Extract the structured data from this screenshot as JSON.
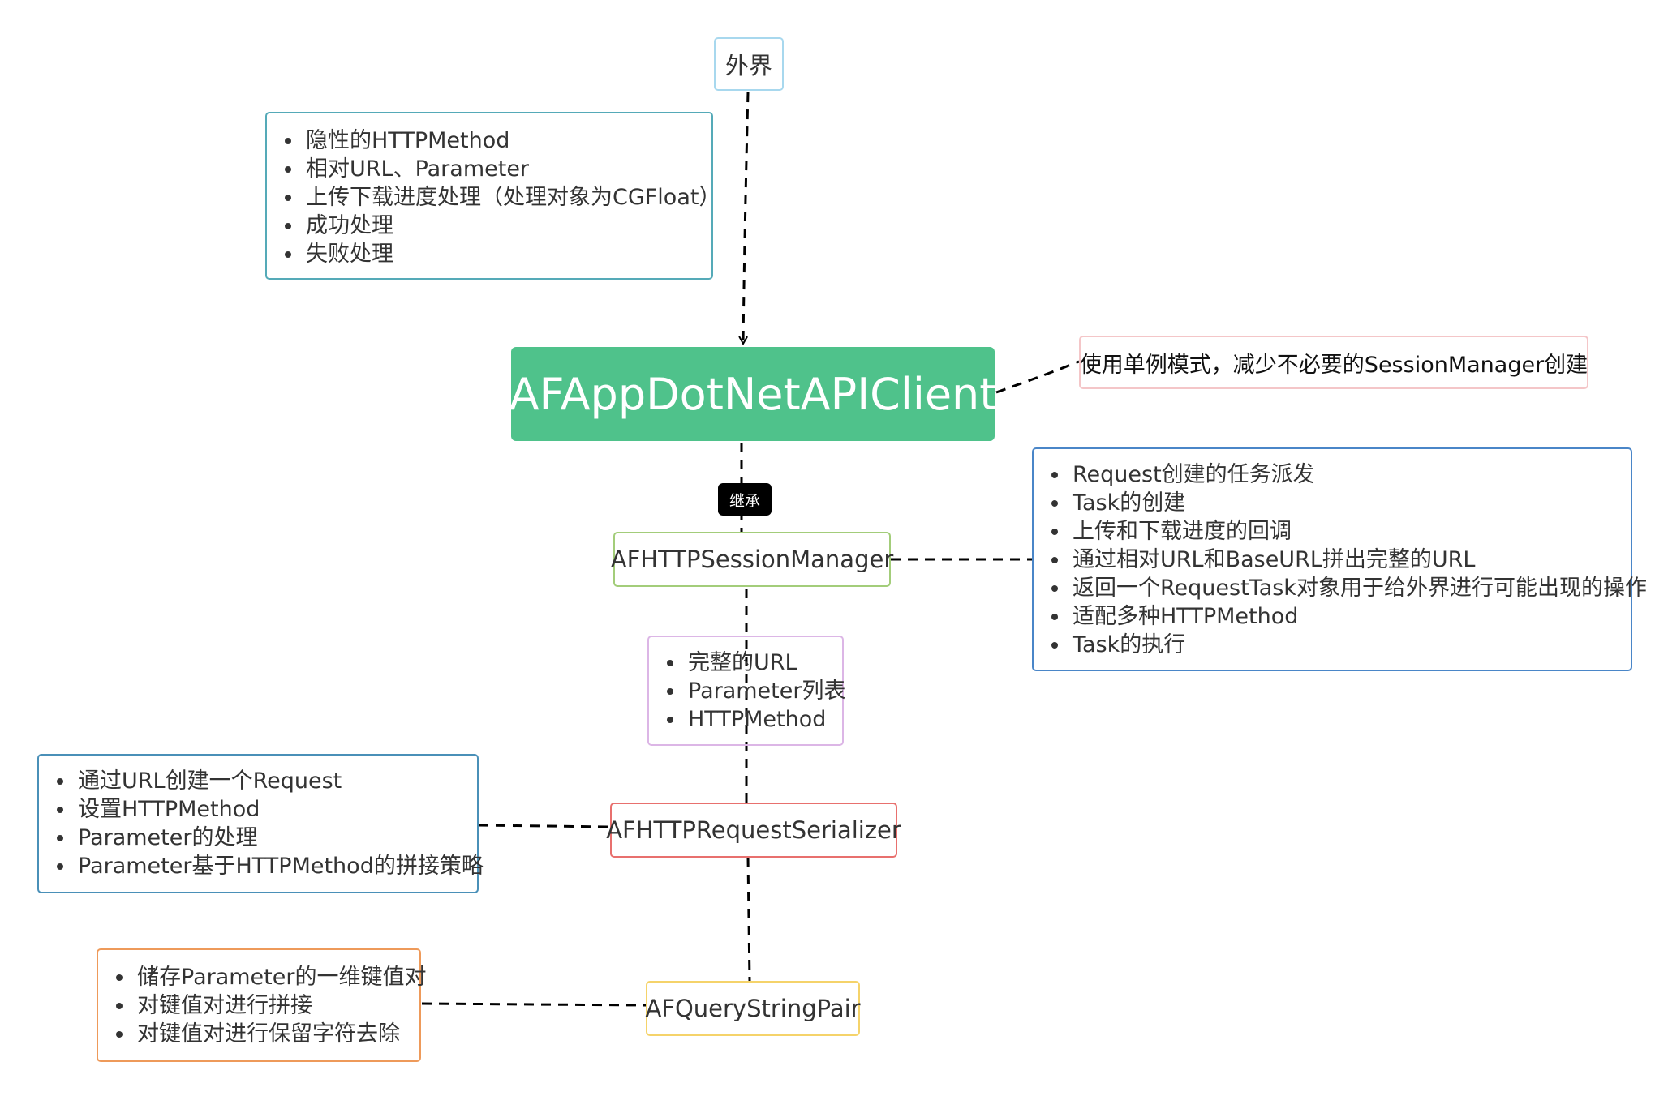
{
  "nodes": {
    "outside": "外界",
    "root": "AFAppDotNetAPIClient",
    "session_manager": "AFHTTPSessionManager",
    "request_serializer": "AFHTTPRequestSerializer",
    "query_string_pair": "AFQueryStringPair"
  },
  "edge_labels": {
    "inherit": "继承"
  },
  "notes": {
    "client_inputs": [
      "隐性的HTTPMethod",
      "相对URL、Parameter",
      "上传下载进度处理（处理对象为CGFloat）",
      "成功处理",
      "失败处理"
    ],
    "singleton": "使用单例模式，减少不必要的SessionManager创建",
    "session_manager_duties": [
      "Request创建的任务派发",
      "Task的创建",
      "上传和下载进度的回调",
      "通过相对URL和BaseURL拼出完整的URL",
      "返回一个RequestTask对象用于给外界进行可能出现的操作",
      "适配多种HTTPMethod",
      "Task的执行"
    ],
    "passed_data": [
      "完整的URL",
      "Parameter列表",
      "HTTPMethod"
    ],
    "serializer_duties": [
      "通过URL创建一个Request",
      "设置HTTPMethod",
      "Parameter的处理",
      "Parameter基于HTTPMethod的拼接策略"
    ],
    "pair_duties": [
      "储存Parameter的一维键值对",
      "对键值对进行拼接",
      "对键值对进行保留字符去除"
    ]
  },
  "colors": {
    "root_fill": "#4fc28b",
    "outside_border": "#a8d8ee",
    "client_inputs_border": "#55aab8",
    "singleton_border": "#f4c6c8",
    "session_manager_border": "#a3cd7a",
    "session_duties_border": "#4a86c8",
    "passed_data_border": "#dcb6e6",
    "serializer_border": "#e8706e",
    "serializer_duties_border": "#4a90b8",
    "pair_border": "#f5d36a",
    "pair_duties_border": "#ee9a5a",
    "edge": "#000000"
  }
}
